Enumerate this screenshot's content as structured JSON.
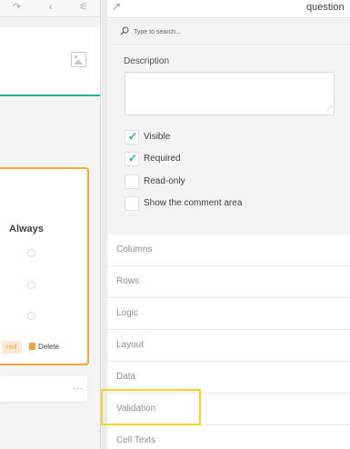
{
  "left_panel": {
    "matrix_question": {
      "column_header": "Always",
      "actions": {
        "required_label": "red",
        "delete_label": "Delete"
      }
    },
    "more_label": "..."
  },
  "panel": {
    "title": "question",
    "search": {
      "placeholder": "Type to search..."
    },
    "description_label": "Description",
    "checkboxes": [
      {
        "label": "Visible",
        "checked": true
      },
      {
        "label": "Required",
        "checked": true
      },
      {
        "label": "Read-only",
        "checked": false
      },
      {
        "label": "Show the comment area",
        "checked": false
      }
    ],
    "categories": [
      {
        "label": "Columns"
      },
      {
        "label": "Rows"
      },
      {
        "label": "Logic"
      },
      {
        "label": "Layout"
      },
      {
        "label": "Data"
      },
      {
        "label": "Validation",
        "highlighted": true
      },
      {
        "label": "Cell Texts"
      }
    ]
  },
  "colors": {
    "accent": "#19b394",
    "selection_border": "#f3a73d",
    "highlight": "#f6d12c"
  }
}
